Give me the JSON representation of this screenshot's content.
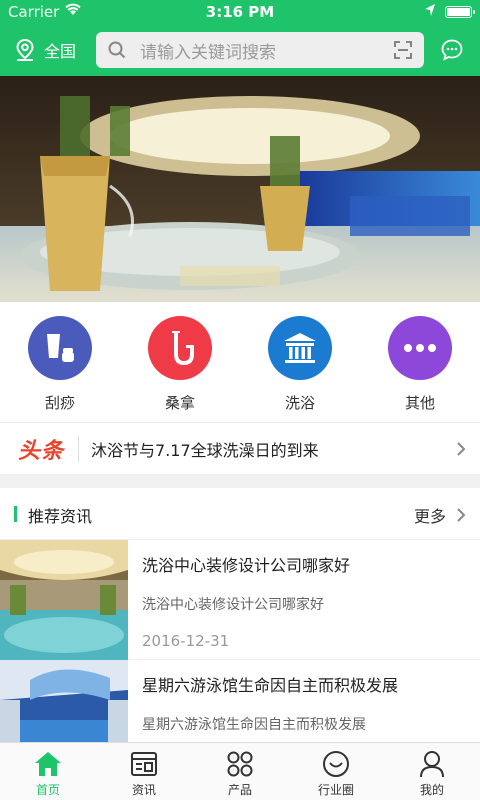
{
  "status": {
    "carrier": "Carrier",
    "time": "3:16 PM"
  },
  "header": {
    "location_label": "全国",
    "search_placeholder": "请输入关键词搜索"
  },
  "categories": [
    {
      "label": "刮痧",
      "color": "#4a5bbb",
      "icon": "cosmetics-icon"
    },
    {
      "label": "桑拿",
      "color": "#ee3b47",
      "icon": "saxophone-icon"
    },
    {
      "label": "洗浴",
      "color": "#1b7bd1",
      "icon": "building-icon"
    },
    {
      "label": "其他",
      "color": "#8e48d9",
      "icon": "more-dots-icon"
    }
  ],
  "headline": {
    "logo": "头条",
    "text": "沐浴节与7.17全球洗澡日的到来"
  },
  "section": {
    "title": "推荐资讯",
    "more": "更多"
  },
  "news": [
    {
      "title": "洗浴中心装修设计公司哪家好",
      "summary": "洗浴中心装修设计公司哪家好",
      "date": "2016-12-31"
    },
    {
      "title": "星期六游泳馆生命因自主而积极发展",
      "summary": "星期六游泳馆生命因自主而积极发展",
      "date": ""
    }
  ],
  "tabs": [
    {
      "label": "首页",
      "icon": "home-icon",
      "active": true
    },
    {
      "label": "资讯",
      "icon": "news-icon",
      "active": false
    },
    {
      "label": "产品",
      "icon": "grid-icon",
      "active": false
    },
    {
      "label": "行业圈",
      "icon": "smile-icon",
      "active": false
    },
    {
      "label": "我的",
      "icon": "person-icon",
      "active": false
    }
  ],
  "colors": {
    "brand": "#1fc36a",
    "headline": "#e8442a"
  }
}
